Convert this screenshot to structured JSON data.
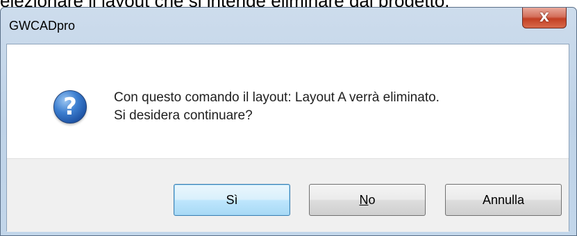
{
  "background_text": "elezionare il layout che si intende eliminare dal progetto.",
  "window": {
    "title": "GWCADpro",
    "close_glyph": "X"
  },
  "dialog": {
    "icon": "question-icon",
    "icon_glyph": "?",
    "message_line1": "Con questo comando il layout: Layout A verrà eliminato.",
    "message_line2": "Si desidera continuare?"
  },
  "buttons": {
    "yes_label": "Sì",
    "no_mnemonic": "N",
    "no_rest": "o",
    "cancel_label": "Annulla"
  },
  "colors": {
    "titlebar": "#c2d6ea",
    "close_button": "#c23f24",
    "question_icon": "#1b4fa0",
    "default_button_border": "#3c7fb1",
    "button_bar": "#f0f0f0"
  }
}
